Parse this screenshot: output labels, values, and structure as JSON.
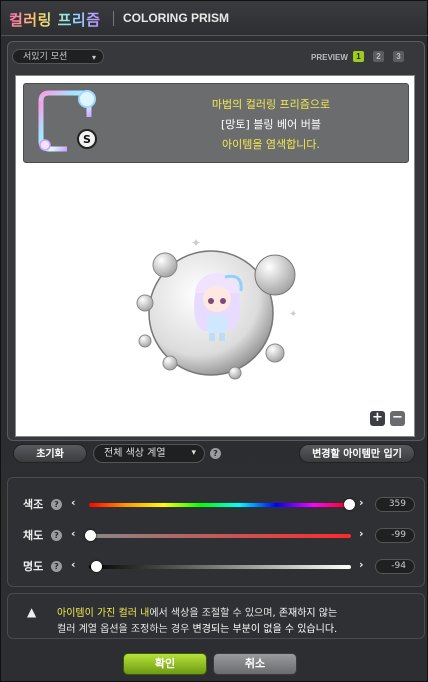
{
  "title": {
    "korean": "컬러링 프리즘",
    "english": "COLORING PRISM"
  },
  "preview": {
    "pose_dropdown": "서있기 모션",
    "label": "PREVIEW",
    "slots": [
      "1",
      "2",
      "3"
    ],
    "info_lines": [
      "마법의 컬러링 프리즘으로",
      "[망토] 블링 베어 버블",
      "아이템을 염색합니다."
    ],
    "zoom_in": "+",
    "zoom_out": "−"
  },
  "actions": {
    "reset_label": "초기화",
    "color_family": "전체 색상 계열",
    "apply_only_label": "변경할 아이템만 입기"
  },
  "sliders": [
    {
      "label": "색조",
      "value": "359",
      "fraction": 0.995
    },
    {
      "label": "채도",
      "value": "-99",
      "fraction": 0.005
    },
    {
      "label": "명도",
      "value": "-94",
      "fraction": 0.03
    }
  ],
  "notice": {
    "p1": "아이템이 가진 컬러 내",
    "p2": "에서 색상을 조절할 수 있으며, ",
    "p3": "존재하지 않는",
    "p4": "컬러 계열 옵션을 조정하는 경우 ",
    "p5": "변경되는 부분이 없을 수 있습니다."
  },
  "buttons": {
    "ok": "확인",
    "cancel": "취소"
  },
  "colors": {
    "accent_green": "#9ccc1c",
    "highlight_yellow": "#f2ea4f"
  },
  "icons": {
    "warning": "warning-icon",
    "help": "help-icon",
    "item": "item-icon"
  }
}
